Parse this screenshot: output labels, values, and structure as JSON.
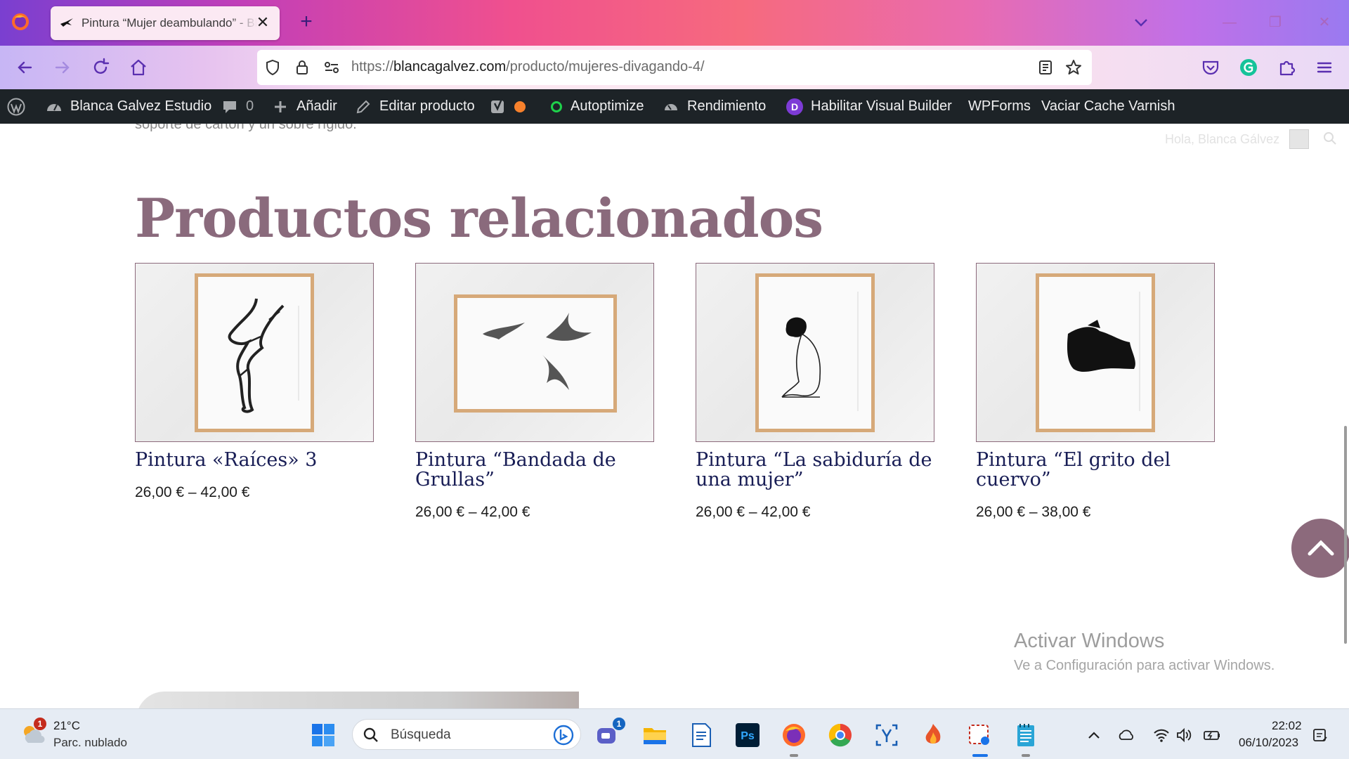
{
  "browser": {
    "tab_title": "Pintura “Mujer deambulando” - Blanca Gálvez",
    "tab_close": "✕",
    "new_tab": "+",
    "url_scheme": "https://",
    "url_host": "blancagalvez.com",
    "url_path": "/producto/mujeres-divagando-4/"
  },
  "adminbar": {
    "site_name": "Blanca Galvez Estudio",
    "comments_count": "0",
    "add_new": "Añadir",
    "edit_product": "Editar producto",
    "autoptimize": "Autoptimize",
    "performance": "Rendimiento",
    "visual_builder": "Habilitar Visual Builder",
    "wpforms": "WPForms",
    "varnish": "Vaciar Cache Varnish",
    "status_orange": "#f7812c",
    "status_green": "#1ed14b"
  },
  "page": {
    "cut_text": "soporte de cartón y un sobre rígido.",
    "greeting": "Hola, Blanca Gálvez",
    "related_title": "Productos relacionados",
    "products": [
      {
        "name": "Pintura «Raíces» 3",
        "price": "26,00 € – 42,00 €",
        "art": "roots-drawing"
      },
      {
        "name": "Pintura “Bandada de Grullas”",
        "price": "26,00 € – 42,00 €",
        "art": "cranes-drawing"
      },
      {
        "name": "Pintura “La sabiduría de una mujer”",
        "price": "26,00 € – 42,00 €",
        "art": "kneeling-woman-drawing"
      },
      {
        "name": "Pintura “El grito del cuervo”",
        "price": "26,00 € – 38,00 €",
        "art": "crow-drawing"
      }
    ],
    "activate_title": "Activar Windows",
    "activate_sub": "Ve a Configuración para activar Windows.",
    "accent": "#8c6a7c",
    "product_title_color": "#181d55"
  },
  "taskbar": {
    "weather_badge": "1",
    "temperature": "21°C",
    "weather_desc": "Parc. nublado",
    "search_placeholder": "Búsqueda",
    "teams_badge": "1",
    "time": "22:02",
    "date": "06/10/2023"
  }
}
